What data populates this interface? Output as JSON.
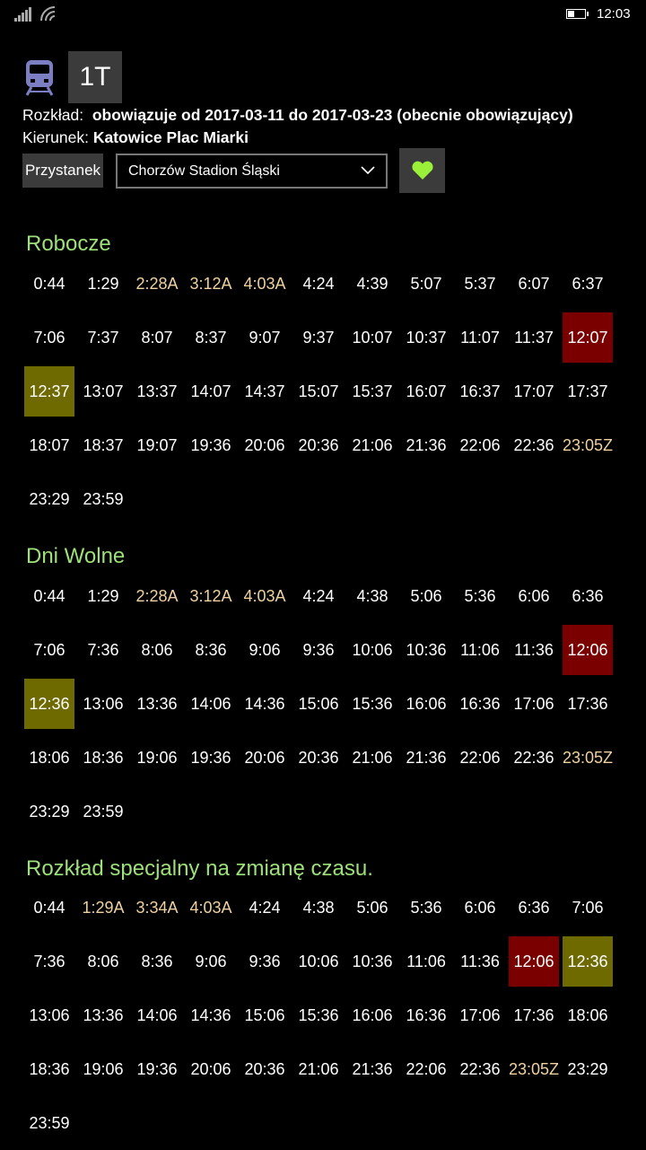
{
  "status_bar": {
    "time": "12:03",
    "battery_level": 0.4
  },
  "header": {
    "line": "1T",
    "tram_icon": "tram-icon",
    "schedule_label": "Rozkład:",
    "schedule_value": "obowiązuje od 2017-03-11 do 2017-03-23 (obecnie obowiązujący)",
    "direction_label": "Kierunek:",
    "direction_value": "Katowice Plac Miarki"
  },
  "stop": {
    "label": "Przystanek",
    "selected": "Chorzów Stadion Śląski",
    "favorite_icon": "heart-icon",
    "favorite_color": "#9bf03a"
  },
  "colors": {
    "title": "#9ee07a",
    "note_time": "#f0d1a0",
    "highlight_red": "#7a0000",
    "highlight_olive": "#6e6a00"
  },
  "sections": [
    {
      "title": "Robocze",
      "times": [
        {
          "t": "0:44"
        },
        {
          "t": "1:29"
        },
        {
          "t": "2:28A",
          "note": true
        },
        {
          "t": "3:12A",
          "note": true
        },
        {
          "t": "4:03A",
          "note": true
        },
        {
          "t": "4:24"
        },
        {
          "t": "4:39"
        },
        {
          "t": "5:07"
        },
        {
          "t": "5:37"
        },
        {
          "t": "6:07"
        },
        {
          "t": "6:37"
        },
        {
          "t": "7:06"
        },
        {
          "t": "7:37"
        },
        {
          "t": "8:07"
        },
        {
          "t": "8:37"
        },
        {
          "t": "9:07"
        },
        {
          "t": "9:37"
        },
        {
          "t": "10:07"
        },
        {
          "t": "10:37"
        },
        {
          "t": "11:07"
        },
        {
          "t": "11:37"
        },
        {
          "t": "12:07",
          "hl": "red"
        },
        {
          "t": "12:37",
          "hl": "olive"
        },
        {
          "t": "13:07"
        },
        {
          "t": "13:37"
        },
        {
          "t": "14:07"
        },
        {
          "t": "14:37"
        },
        {
          "t": "15:07"
        },
        {
          "t": "15:37"
        },
        {
          "t": "16:07"
        },
        {
          "t": "16:37"
        },
        {
          "t": "17:07"
        },
        {
          "t": "17:37"
        },
        {
          "t": "18:07"
        },
        {
          "t": "18:37"
        },
        {
          "t": "19:07"
        },
        {
          "t": "19:36"
        },
        {
          "t": "20:06"
        },
        {
          "t": "20:36"
        },
        {
          "t": "21:06"
        },
        {
          "t": "21:36"
        },
        {
          "t": "22:06"
        },
        {
          "t": "22:36"
        },
        {
          "t": "23:05Z",
          "note": true
        },
        {
          "t": "23:29"
        },
        {
          "t": "23:59"
        }
      ]
    },
    {
      "title": "Dni Wolne",
      "times": [
        {
          "t": "0:44"
        },
        {
          "t": "1:29"
        },
        {
          "t": "2:28A",
          "note": true
        },
        {
          "t": "3:12A",
          "note": true
        },
        {
          "t": "4:03A",
          "note": true
        },
        {
          "t": "4:24"
        },
        {
          "t": "4:38"
        },
        {
          "t": "5:06"
        },
        {
          "t": "5:36"
        },
        {
          "t": "6:06"
        },
        {
          "t": "6:36"
        },
        {
          "t": "7:06"
        },
        {
          "t": "7:36"
        },
        {
          "t": "8:06"
        },
        {
          "t": "8:36"
        },
        {
          "t": "9:06"
        },
        {
          "t": "9:36"
        },
        {
          "t": "10:06"
        },
        {
          "t": "10:36"
        },
        {
          "t": "11:06"
        },
        {
          "t": "11:36"
        },
        {
          "t": "12:06",
          "hl": "red"
        },
        {
          "t": "12:36",
          "hl": "olive"
        },
        {
          "t": "13:06"
        },
        {
          "t": "13:36"
        },
        {
          "t": "14:06"
        },
        {
          "t": "14:36"
        },
        {
          "t": "15:06"
        },
        {
          "t": "15:36"
        },
        {
          "t": "16:06"
        },
        {
          "t": "16:36"
        },
        {
          "t": "17:06"
        },
        {
          "t": "17:36"
        },
        {
          "t": "18:06"
        },
        {
          "t": "18:36"
        },
        {
          "t": "19:06"
        },
        {
          "t": "19:36"
        },
        {
          "t": "20:06"
        },
        {
          "t": "20:36"
        },
        {
          "t": "21:06"
        },
        {
          "t": "21:36"
        },
        {
          "t": "22:06"
        },
        {
          "t": "22:36"
        },
        {
          "t": "23:05Z",
          "note": true
        },
        {
          "t": "23:29"
        },
        {
          "t": "23:59"
        }
      ]
    },
    {
      "title": "Rozkład specjalny na zmianę czasu.",
      "times": [
        {
          "t": "0:44"
        },
        {
          "t": "1:29A",
          "note": true
        },
        {
          "t": "3:34A",
          "note": true
        },
        {
          "t": "4:03A",
          "note": true
        },
        {
          "t": "4:24"
        },
        {
          "t": "4:38"
        },
        {
          "t": "5:06"
        },
        {
          "t": "5:36"
        },
        {
          "t": "6:06"
        },
        {
          "t": "6:36"
        },
        {
          "t": "7:06"
        },
        {
          "t": "7:36"
        },
        {
          "t": "8:06"
        },
        {
          "t": "8:36"
        },
        {
          "t": "9:06"
        },
        {
          "t": "9:36"
        },
        {
          "t": "10:06"
        },
        {
          "t": "10:36"
        },
        {
          "t": "11:06"
        },
        {
          "t": "11:36"
        },
        {
          "t": "12:06",
          "hl": "red"
        },
        {
          "t": "12:36",
          "hl": "olive"
        },
        {
          "t": "13:06"
        },
        {
          "t": "13:36"
        },
        {
          "t": "14:06"
        },
        {
          "t": "14:36"
        },
        {
          "t": "15:06"
        },
        {
          "t": "15:36"
        },
        {
          "t": "16:06"
        },
        {
          "t": "16:36"
        },
        {
          "t": "17:06"
        },
        {
          "t": "17:36"
        },
        {
          "t": "18:06"
        },
        {
          "t": "18:36"
        },
        {
          "t": "19:06"
        },
        {
          "t": "19:36"
        },
        {
          "t": "20:06"
        },
        {
          "t": "20:36"
        },
        {
          "t": "21:06"
        },
        {
          "t": "21:36"
        },
        {
          "t": "22:06"
        },
        {
          "t": "22:36"
        },
        {
          "t": "23:05Z",
          "note": true
        },
        {
          "t": "23:29"
        },
        {
          "t": "23:59"
        }
      ]
    }
  ]
}
